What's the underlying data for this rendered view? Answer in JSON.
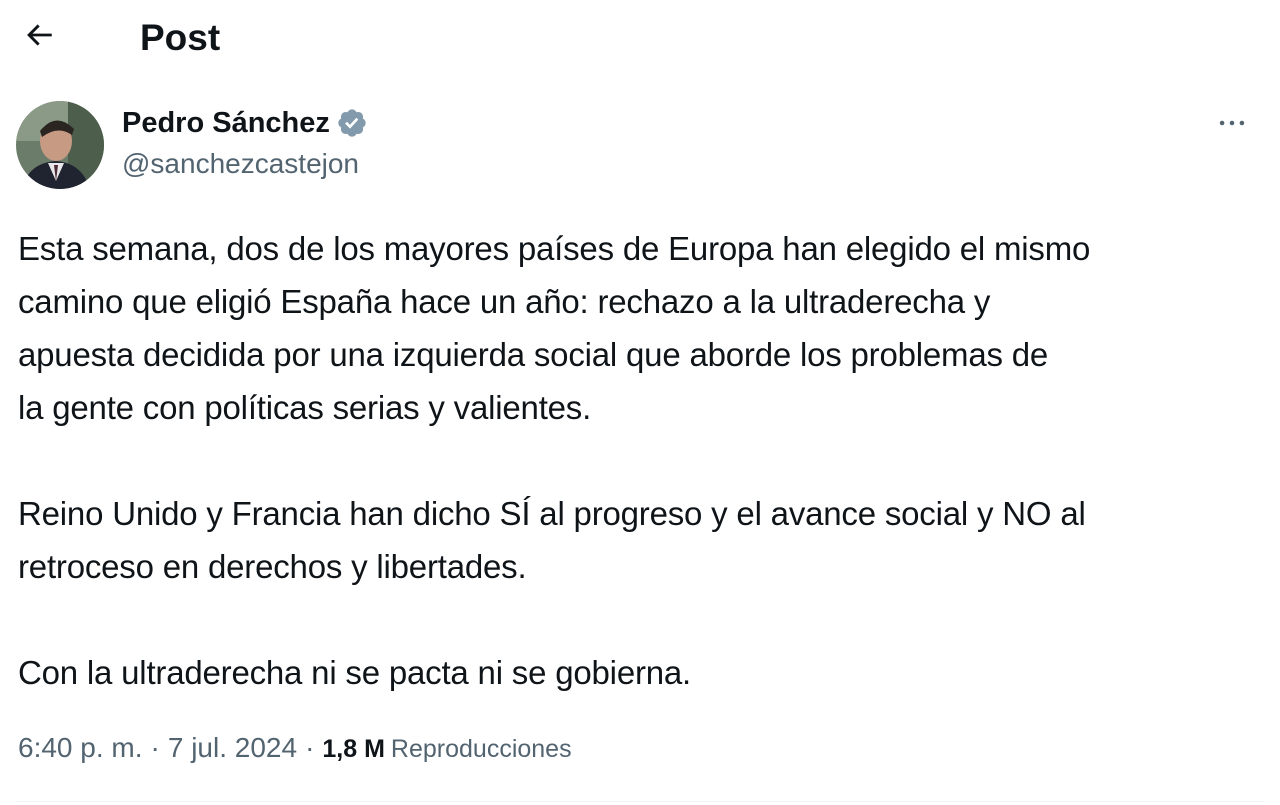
{
  "header": {
    "title": "Post",
    "back_icon": "arrow-left-icon"
  },
  "post": {
    "author": {
      "name": "Pedro Sánchez",
      "handle": "@sanchezcastejon",
      "verified": true,
      "verified_icon": "verified-badge-icon",
      "verified_color": "#829aab"
    },
    "more_icon": "more-horizontal-icon",
    "paragraphs": [
      "Esta semana, dos de los mayores países de Europa han elegido el mismo\ncamino que eligió España hace un año: rechazo a la ultraderecha y\napuesta decidida por una izquierda social que aborde los problemas de\nla gente con políticas serias y valientes.",
      "Reino Unido y Francia han dicho SÍ al progreso y el avance social y NO al\nretroceso en derechos y libertades.",
      "Con la ultraderecha ni se pacta ni se gobierna."
    ],
    "meta": {
      "time": "6:40 p. m.",
      "separator": "·",
      "date": "7 jul. 2024",
      "views_count": "1,8 M",
      "views_label": "Reproducciones"
    }
  },
  "colors": {
    "text_primary": "#0f1419",
    "text_secondary": "#536471",
    "divider": "#eff3f4"
  }
}
